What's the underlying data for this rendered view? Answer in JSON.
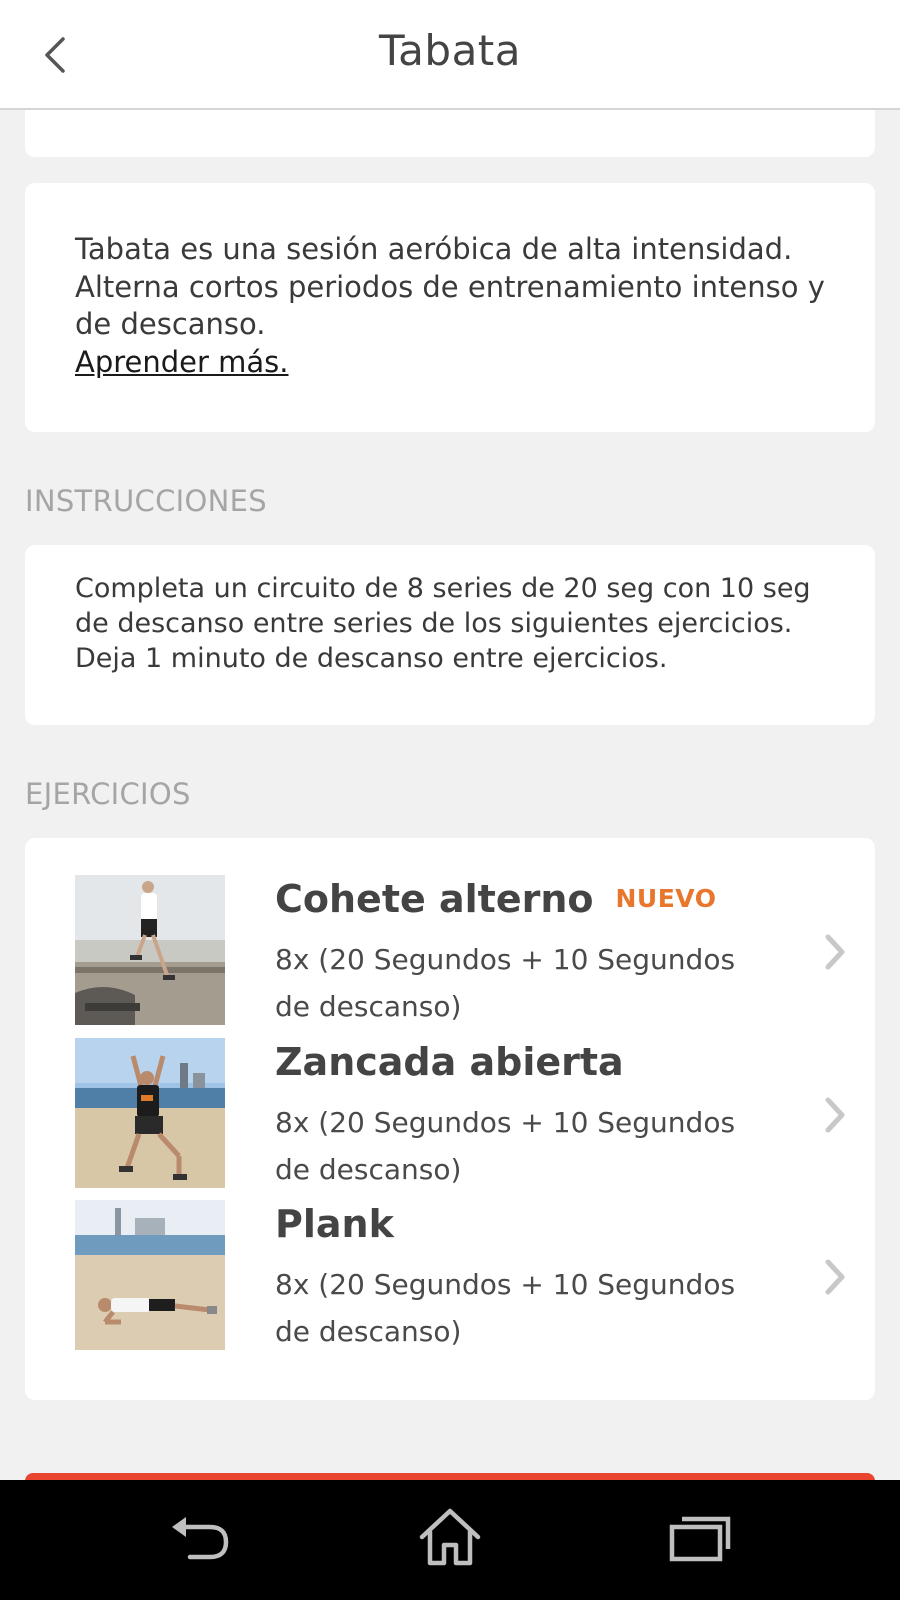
{
  "header": {
    "title": "Tabata",
    "back_icon": "chevron-left-icon"
  },
  "intro": {
    "text": "Tabata es una sesión aeróbica de alta intensidad. Alterna cortos periodos de entrenamiento intenso y de descanso.",
    "link": "Aprender más."
  },
  "instructions": {
    "label": "INSTRUCCIONES",
    "text": "Completa un circuito de 8 series de 20 seg con 10 seg de descanso entre series de los siguientes ejercicios. Deja 1 minuto de descanso entre ejercicios."
  },
  "exercises": {
    "label": "EJERCICIOS",
    "items": [
      {
        "title": "Cohete alterno",
        "badge": "NUEVO",
        "desc": "8x (20 Segundos + 10 Segundos de descanso)"
      },
      {
        "title": "Zancada abierta",
        "badge": "",
        "desc": "8x (20 Segundos + 10 Segundos de descanso)"
      },
      {
        "title": "Plank",
        "badge": "",
        "desc": "8x (20 Segundos + 10 Segundos de descanso)"
      }
    ]
  },
  "colors": {
    "badge": "#e8762c",
    "cta": "#e8442f",
    "background": "#f1f1f1"
  },
  "navbar": {
    "icons": [
      "back-arrow-icon",
      "home-icon",
      "recent-apps-icon"
    ]
  }
}
